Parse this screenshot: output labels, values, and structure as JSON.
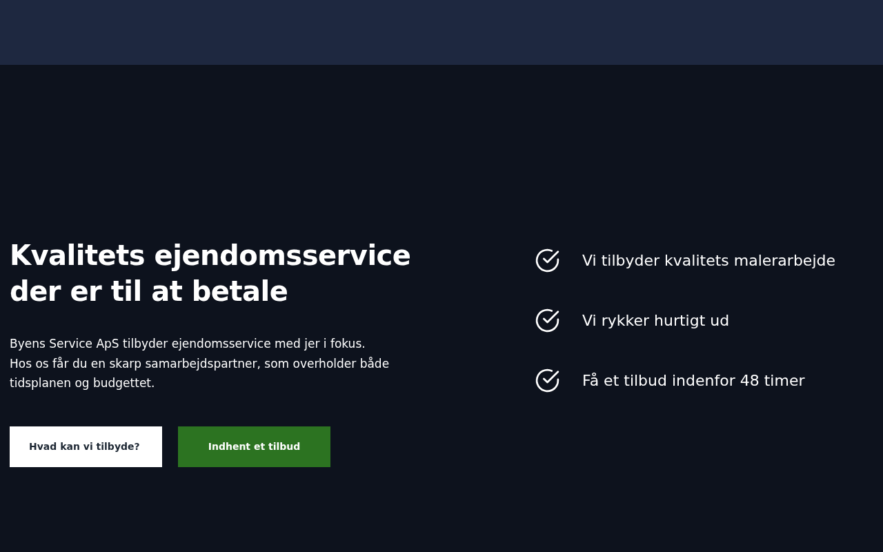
{
  "hero": {
    "title_lines": [
      "Kvalitets ejendomsservice",
      "der er til at betale"
    ],
    "description": [
      "Byens Service ApS tilbyder ejendomsservice med jer i fokus.",
      "Hos os får du en skarp samarbejdspartner, som overholder både tidsplanen og budgettet."
    ],
    "buttons": [
      {
        "label": "Hvad kan vi tilbyde?",
        "kind": "light"
      },
      {
        "label": "Indhent et tilbud",
        "kind": "green"
      }
    ]
  },
  "features": [
    {
      "text": "Vi tilbyder kvalitets malerarbejde"
    },
    {
      "text": "Vi rykker hurtigt ud"
    },
    {
      "text": "Få et tilbud indenfor 48 timer"
    }
  ]
}
